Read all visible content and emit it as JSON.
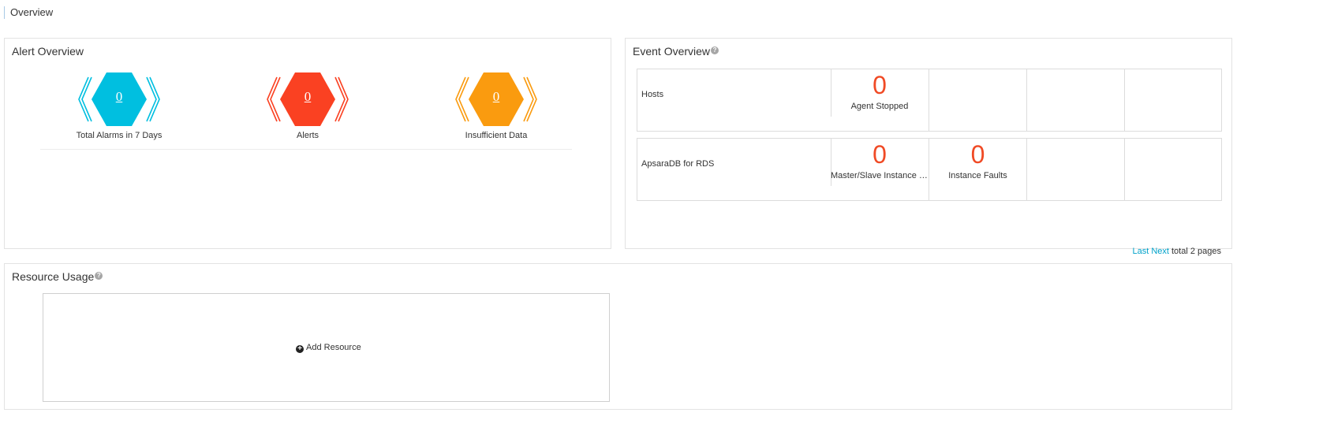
{
  "page": {
    "title": "Overview"
  },
  "alert_overview": {
    "title": "Alert Overview",
    "items": [
      {
        "value": "0",
        "label": "Total Alarms in 7 Days",
        "color": "#00bfe0"
      },
      {
        "value": "0",
        "label": "Alerts",
        "color": "#fa4122"
      },
      {
        "value": "0",
        "label": "Insufficient Data",
        "color": "#fa9b0f"
      }
    ]
  },
  "event_overview": {
    "title": "Event Overview",
    "help_icon": "question-circle-icon",
    "rows": [
      {
        "name": "Hosts",
        "cells": [
          {
            "count": "0",
            "label": "Agent Stopped"
          },
          {
            "count": "",
            "label": ""
          },
          {
            "count": "",
            "label": ""
          },
          {
            "count": "",
            "label": ""
          }
        ]
      },
      {
        "name": "ApsaraDB for RDS",
        "cells": [
          {
            "count": "0",
            "label": "Master/Slave Instance S..."
          },
          {
            "count": "0",
            "label": "Instance Faults"
          },
          {
            "count": "",
            "label": ""
          },
          {
            "count": "",
            "label": ""
          }
        ]
      }
    ],
    "pager": {
      "last_label": "Last",
      "next_label": "Next",
      "total_label": "total 2 pages"
    },
    "count_color": "#f04a25",
    "link_color": "#00a2ca"
  },
  "resource_usage": {
    "title": "Resource Usage",
    "help_icon": "question-circle-icon",
    "add_resource_label": "Add Resource",
    "add_icon": "plus-circle-icon"
  }
}
